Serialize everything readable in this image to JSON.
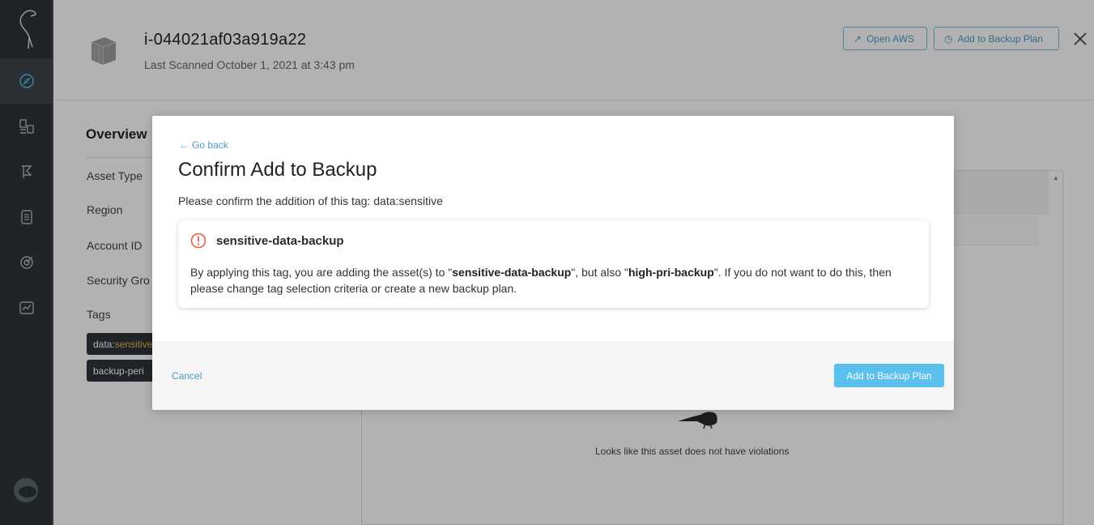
{
  "header": {
    "asset_id": "i-044021af03a919a22",
    "last_scanned": "Last Scanned October 1, 2021 at 3:43 pm",
    "open_aws_label": "Open AWS",
    "add_backup_label": "Add to Backup Plan"
  },
  "overview": {
    "title": "Overview",
    "fields": [
      "Asset Type",
      "Region",
      "Account ID",
      "Security Gro",
      "Tags"
    ],
    "tags": [
      {
        "key": "data: ",
        "value": "sensitive"
      },
      {
        "key": "backup-peri",
        "value": ""
      }
    ]
  },
  "violations": {
    "empty_text": "Looks like this asset does not have violations"
  },
  "modal": {
    "go_back": "Go back",
    "title": "Confirm Add to Backup",
    "confirm_text": "Please confirm the addition of this tag: data:sensitive",
    "warning_title": "sensitive-data-backup",
    "warning_body": {
      "part1": "By applying this tag, you are adding the asset(s) to \"",
      "plan1": "sensitive-data-backup",
      "part2": "\", but also \"",
      "plan2": "high-pri-backup",
      "part3": "\".  If you do not want to do this, then please change tag selection criteria or create a new backup plan."
    },
    "cancel_label": "Cancel",
    "submit_label": "Add to Backup Plan"
  },
  "colors": {
    "accent": "#4a9cc4",
    "primary_button": "#5bc0ee",
    "warning": "#e8603c",
    "sidebar": "#2f3338"
  },
  "icons": {
    "sidebar": [
      "logo-icon",
      "compass-icon",
      "dashboard-icon",
      "flag-icon",
      "document-icon",
      "target-icon",
      "chart-icon"
    ],
    "warning": "exclamation-circle-icon"
  }
}
